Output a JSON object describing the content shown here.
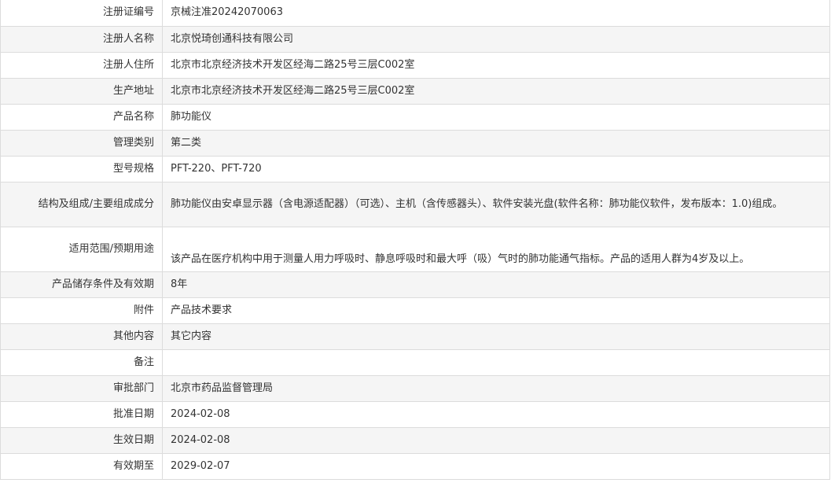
{
  "rows": [
    {
      "label": "注册证编号",
      "value": "京械注准20242070063"
    },
    {
      "label": "注册人名称",
      "value": "北京悦琦创通科技有限公司"
    },
    {
      "label": "注册人住所",
      "value": "北京市北京经济技术开发区经海二路25号三层C002室"
    },
    {
      "label": "生产地址",
      "value": "北京市北京经济技术开发区经海二路25号三层C002室"
    },
    {
      "label": "产品名称",
      "value": "肺功能仪"
    },
    {
      "label": "管理类别",
      "value": "第二类"
    },
    {
      "label": "型号规格",
      "value": "PFT-220、PFT-720"
    },
    {
      "label": "结构及组成/主要组成成分",
      "value": "肺功能仪由安卓显示器（含电源适配器）（可选）、主机（含传感器头）、软件安装光盘(软件名称：肺功能仪软件，发布版本：1.0)组成。"
    },
    {
      "label": "适用范围/预期用途",
      "value": "该产品在医疗机构中用于测量人用力呼吸时、静息呼吸时和最大呼（吸）气时的肺功能通气指标。产品的适用人群为4岁及以上。"
    },
    {
      "label": "产品储存条件及有效期",
      "value": "8年"
    },
    {
      "label": "附件",
      "value": "产品技术要求"
    },
    {
      "label": "其他内容",
      "value": "其它内容"
    },
    {
      "label": "备注",
      "value": ""
    },
    {
      "label": "审批部门",
      "value": "北京市药品监督管理局"
    },
    {
      "label": "批准日期",
      "value": "2024-02-08"
    },
    {
      "label": "生效日期",
      "value": "2024-02-08"
    },
    {
      "label": "有效期至",
      "value": "2029-02-07"
    }
  ]
}
